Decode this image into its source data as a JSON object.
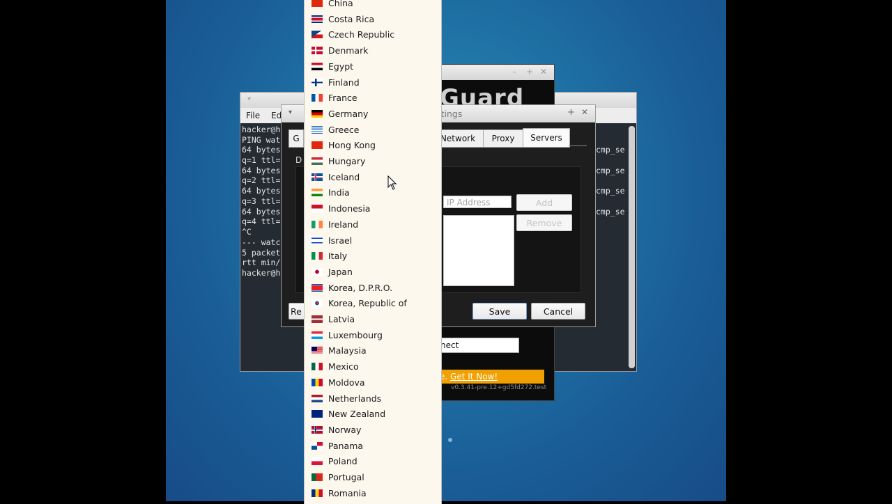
{
  "terminal": {
    "menu": [
      "File",
      "Ed"
    ],
    "lines": [
      "hacker@ha",
      "PING watc",
      "64 bytes",
      "q=1 ttl=",
      "64 bytes",
      "q=2 ttl=",
      "64 bytes",
      "q=3 ttl=",
      "64 bytes",
      "q=4 ttl=",
      "^C",
      "--- watc",
      "5 packet",
      "rtt min/a",
      "hacker@ha"
    ],
    "right_lines": [
      "cmp_se",
      "cmp_se",
      "cmp_se",
      "cmp_se"
    ]
  },
  "vpn": {
    "title_fragment": "Guard",
    "connect_fragment": "nect",
    "promo_prefix": "e.",
    "promo_link": "Get It Now!",
    "version": "v0.3.41-pre.12+gd5fd272.test"
  },
  "settings": {
    "title_fragment": "ettings",
    "tabs": [
      "G",
      "Network",
      "Proxy",
      "Servers"
    ],
    "label_fragment": "D",
    "ip_placeholder": "IP Address",
    "add_label": "Add",
    "remove_label": "Remove",
    "reset_fragment": "Re",
    "save_label": "Save",
    "cancel_label": "Cancel"
  },
  "countries": [
    {
      "name": "China",
      "flag": "cn"
    },
    {
      "name": "Costa Rica",
      "flag": "cr"
    },
    {
      "name": "Czech Republic",
      "flag": "cz"
    },
    {
      "name": "Denmark",
      "flag": "dk"
    },
    {
      "name": "Egypt",
      "flag": "eg"
    },
    {
      "name": "Finland",
      "flag": "fi"
    },
    {
      "name": "France",
      "flag": "fr"
    },
    {
      "name": "Germany",
      "flag": "de"
    },
    {
      "name": "Greece",
      "flag": "gr"
    },
    {
      "name": "Hong Kong",
      "flag": "hk"
    },
    {
      "name": "Hungary",
      "flag": "hu"
    },
    {
      "name": "Iceland",
      "flag": "is"
    },
    {
      "name": "India",
      "flag": "in"
    },
    {
      "name": "Indonesia",
      "flag": "id"
    },
    {
      "name": "Ireland",
      "flag": "ie"
    },
    {
      "name": "Israel",
      "flag": "il"
    },
    {
      "name": "Italy",
      "flag": "it"
    },
    {
      "name": "Japan",
      "flag": "jp"
    },
    {
      "name": "Korea, D.P.R.O.",
      "flag": "kp"
    },
    {
      "name": "Korea, Republic of",
      "flag": "kr"
    },
    {
      "name": "Latvia",
      "flag": "lv"
    },
    {
      "name": "Luxembourg",
      "flag": "lu"
    },
    {
      "name": "Malaysia",
      "flag": "my"
    },
    {
      "name": "Mexico",
      "flag": "mx"
    },
    {
      "name": "Moldova",
      "flag": "md"
    },
    {
      "name": "Netherlands",
      "flag": "nl"
    },
    {
      "name": "New Zealand",
      "flag": "nz"
    },
    {
      "name": "Norway",
      "flag": "no"
    },
    {
      "name": "Panama",
      "flag": "pa"
    },
    {
      "name": "Poland",
      "flag": "pl"
    },
    {
      "name": "Portugal",
      "flag": "pt"
    },
    {
      "name": "Romania",
      "flag": "ro"
    }
  ],
  "colors": {
    "desktop": "#1f73a6",
    "dropdown_bg": "#fcf8ee",
    "promo": "#f0a000"
  }
}
